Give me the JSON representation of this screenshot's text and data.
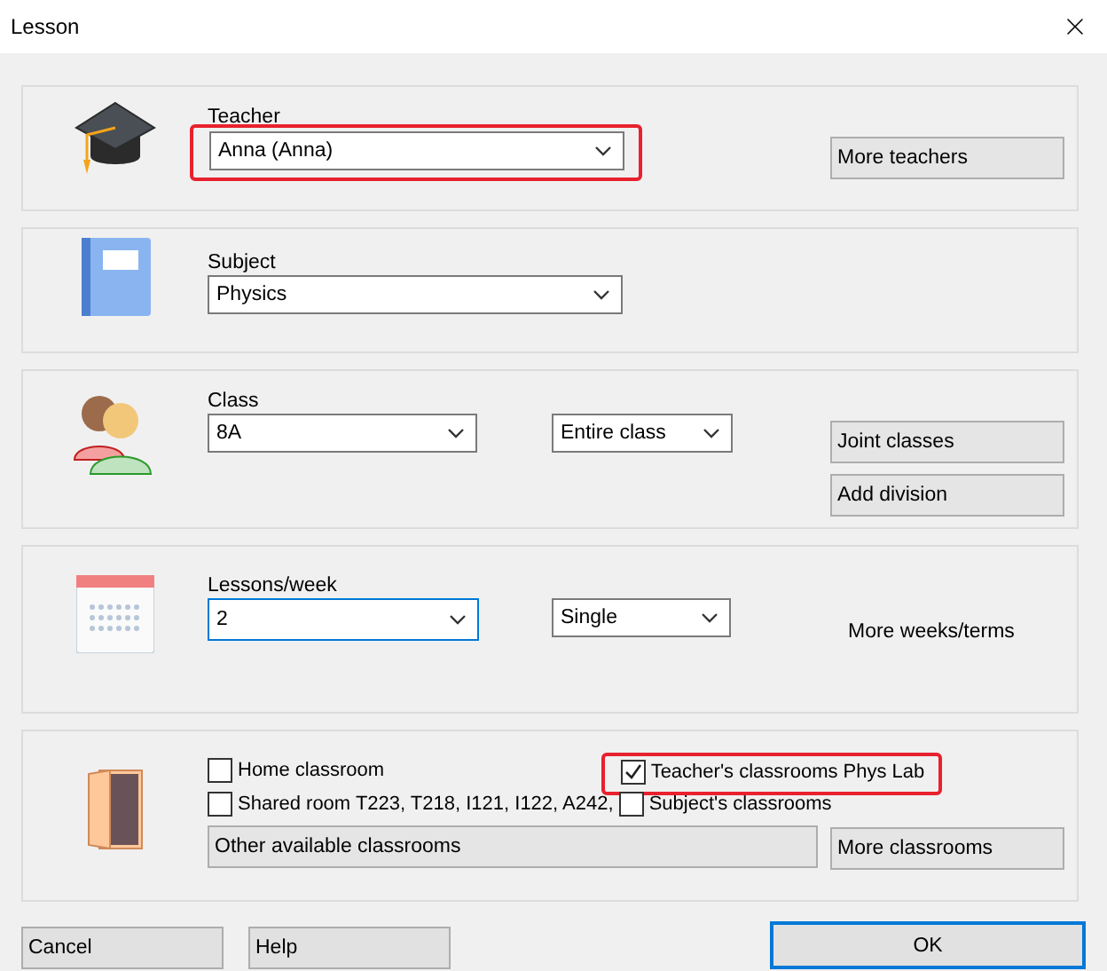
{
  "window": {
    "title": "Lesson"
  },
  "teacher": {
    "label": "Teacher",
    "value": "Anna (Anna)",
    "highlighted": true,
    "button": "More teachers"
  },
  "subject": {
    "label": "Subject",
    "value": "Physics"
  },
  "class": {
    "label": "Class",
    "value": "8A",
    "group": "Entire class",
    "buttons": [
      "Joint classes",
      "Add division"
    ]
  },
  "lessons": {
    "label": "Lessons/week",
    "value": "2",
    "focused": true,
    "length": "Single",
    "link": "More weeks/terms"
  },
  "classrooms": {
    "checkboxes": [
      {
        "label": "Home classroom",
        "checked": false,
        "highlighted": false
      },
      {
        "label": "Teacher's classrooms Phys Lab",
        "checked": true,
        "highlighted": true
      },
      {
        "label": "Shared room T223, T218, I121, I122, A242,",
        "checked": false,
        "highlighted": false
      },
      {
        "label": "Subject's classrooms",
        "checked": false,
        "highlighted": false
      }
    ],
    "buttons": [
      "Other available classrooms",
      "More classrooms"
    ]
  },
  "footer": {
    "buttons": [
      {
        "label": "Cancel",
        "kind": "plain"
      },
      {
        "label": "Help",
        "kind": "plain"
      },
      {
        "label": "OK",
        "kind": "default"
      }
    ]
  }
}
